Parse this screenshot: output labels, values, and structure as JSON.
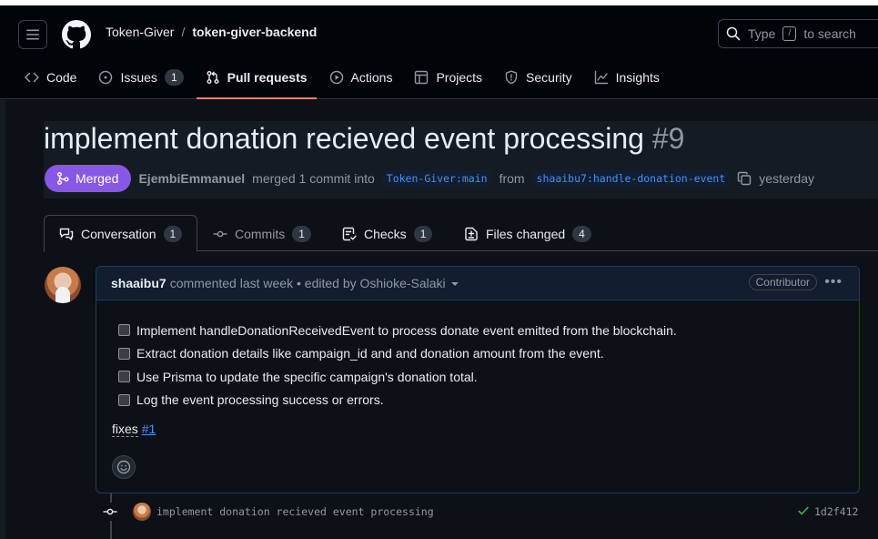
{
  "colors": {
    "page_bg": "#0d1117",
    "header_bg": "#010409",
    "merged": "#8957e5",
    "link": "#4493f8",
    "active_tab_underline": "#f78166",
    "success": "#3fb950"
  },
  "header": {
    "owner": "Token-Giver",
    "separator": "/",
    "repo": "token-giver-backend",
    "search": {
      "before": "Type",
      "key": "/",
      "after": "to search"
    }
  },
  "reponav": {
    "code": {
      "label": "Code",
      "icon": "code-icon"
    },
    "issues": {
      "label": "Issues",
      "count": "1",
      "icon": "issue-opened-icon"
    },
    "pulls": {
      "label": "Pull requests",
      "icon": "git-pull-request-icon"
    },
    "actions": {
      "label": "Actions",
      "icon": "play-icon"
    },
    "projects": {
      "label": "Projects",
      "icon": "table-icon"
    },
    "security": {
      "label": "Security",
      "icon": "shield-icon"
    },
    "insights": {
      "label": "Insights",
      "icon": "graph-icon"
    }
  },
  "pr": {
    "title": "implement donation recieved event processing",
    "number": "#9",
    "state": "Merged",
    "author": "EjembiEmmanuel",
    "action_text": "merged 1 commit into",
    "base_branch": "Token-Giver:main",
    "from_text": "from",
    "head_branch": "shaaibu7:handle-donation-event",
    "time": "yesterday"
  },
  "tabs": {
    "conversation": {
      "label": "Conversation",
      "count": "1"
    },
    "commits": {
      "label": "Commits",
      "count": "1"
    },
    "checks": {
      "label": "Checks",
      "count": "1"
    },
    "files": {
      "label": "Files changed",
      "count": "4"
    }
  },
  "comment": {
    "author": "shaaibu7",
    "when": "commented last week",
    "edited": "• edited by Oshioke-Salaki",
    "role": "Contributor",
    "tasks": [
      "Implement handleDonationReceivedEvent to process donate event emitted from the blockchain.",
      "Extract donation details like campaign_id and and donation amount from the event.",
      "Use Prisma to update the specific campaign's donation total.",
      "Log the event processing success or errors."
    ],
    "fixes_label": "fixes",
    "fixes_ref": "#1"
  },
  "commit": {
    "message": "implement donation recieved event processing",
    "sha": "1d2f412"
  }
}
